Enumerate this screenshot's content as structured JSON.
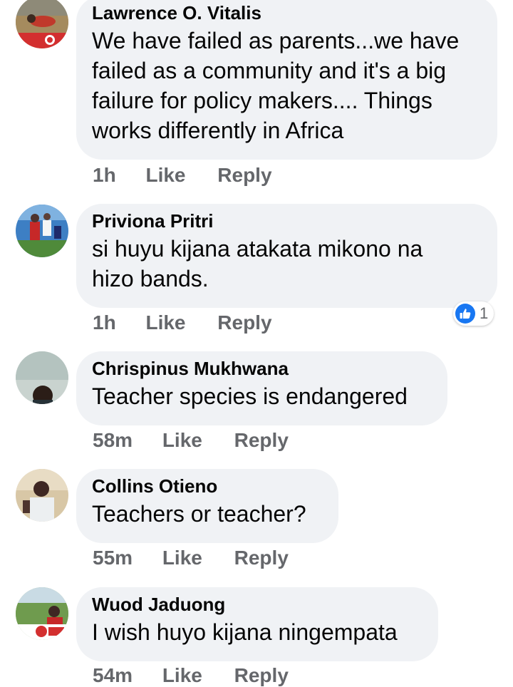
{
  "comments": [
    {
      "author": "Lawrence O. Vitalis",
      "text": "We have failed as parents...we have\nfailed as a community and it's a big\nfailure for policy makers.... Things\nworks differently in Africa",
      "time": "1h",
      "like_label": "Like",
      "reply_label": "Reply"
    },
    {
      "author": "Priviona Pritri",
      "text": "si huyu kijana atakata mikono na\nhizo bands.",
      "time": "1h",
      "like_label": "Like",
      "reply_label": "Reply",
      "reaction": {
        "icon": "like-icon",
        "count": "1",
        "color": "#1877f2"
      }
    },
    {
      "author": "Chrispinus Mukhwana",
      "text": "Teacher species is endangered",
      "time": "58m",
      "like_label": "Like",
      "reply_label": "Reply"
    },
    {
      "author": "Collins Otieno",
      "text": "Teachers or teacher?",
      "time": "55m",
      "like_label": "Like",
      "reply_label": "Reply"
    },
    {
      "author": "Wuod Jaduong",
      "text": "I wish huyo kijana ningempata",
      "time": "54m",
      "like_label": "Like",
      "reply_label": "Reply"
    }
  ],
  "colors": {
    "bubble": "#f0f2f5",
    "meta": "#65676b",
    "text": "#050505",
    "accent": "#1877f2"
  }
}
